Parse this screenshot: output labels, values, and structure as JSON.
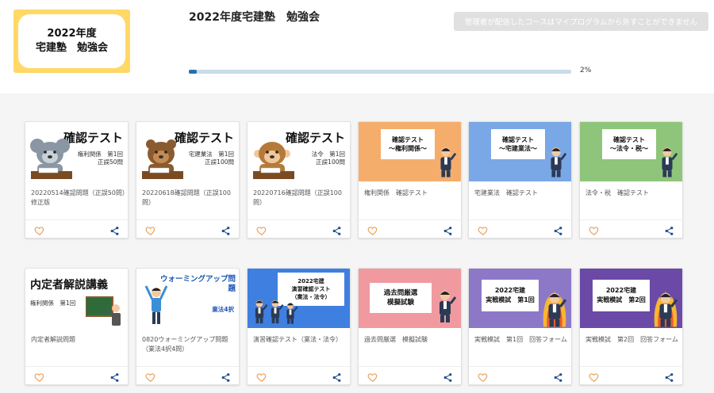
{
  "logo": {
    "line1": "2022年度",
    "line2": "宅建塾　勉強会"
  },
  "course": {
    "title": "2022年度宅建塾　勉強会"
  },
  "notice": {
    "label": "管理者が配信したコースはマイプログラムから外すことができません"
  },
  "progress": {
    "percent": 2,
    "label": "2%"
  },
  "colors": {
    "accent": "#2a6fb0",
    "logo_bg": "#ffd866",
    "heart": "#e9a15a",
    "share": "#1d4f8c"
  },
  "cards": [
    {
      "type": "quiz",
      "thumb_title": "確認テスト",
      "thumb_sub1": "権利関係　第1回",
      "thumb_sub2": "正誤50問",
      "animal": "koala",
      "text": "20220514確認問題（正誤50問）修正版"
    },
    {
      "type": "quiz",
      "thumb_title": "確認テスト",
      "thumb_sub1": "宅建業法　第1回",
      "thumb_sub2": "正誤100問",
      "animal": "bear",
      "text": "20220618確認問題（正誤100問）"
    },
    {
      "type": "quiz",
      "thumb_title": "確認テスト",
      "thumb_sub1": "法令　第1回",
      "thumb_sub2": "正誤100問",
      "animal": "monkey",
      "text": "20220716確認問題（正誤100問）"
    },
    {
      "type": "banner",
      "bg": "#f5ad6c",
      "thumb_line1": "確認テスト",
      "thumb_line2": "～権利関係～",
      "text": "権利関係　確認テスト"
    },
    {
      "type": "banner",
      "bg": "#7aa7e6",
      "thumb_line1": "確認テスト",
      "thumb_line2": "～宅建業法～",
      "text": "宅建業法　確認テスト"
    },
    {
      "type": "banner",
      "bg": "#8fc57a",
      "thumb_line1": "確認テスト",
      "thumb_line2": "～法令・税～",
      "text": "法令・税　確認テスト"
    },
    {
      "type": "lecture",
      "thumb_title": "内定者解説講義",
      "thumb_sub1": "権利関係　第1回",
      "text": "内定者解説問題"
    },
    {
      "type": "warmup",
      "thumb_title": "ウォーミングアップ問題",
      "thumb_sub1": "業法4択",
      "text": "0820ウォーミングアップ問題（業法4択4問）"
    },
    {
      "type": "banner3",
      "bg": "#3f7fe0",
      "thumb_line1": "2022宅建",
      "thumb_line2": "演習確認テスト",
      "thumb_line3": "（業法・法令）",
      "text": "演習確認テスト（業法・法令）"
    },
    {
      "type": "banner2",
      "bg": "#f09aa0",
      "thumb_line1": "過去問厳選",
      "thumb_line2": "模擬試験",
      "text": "過去問厳選　模擬試験"
    },
    {
      "type": "exam",
      "bg": "#8d78c8",
      "thumb_line1": "2022宅建",
      "thumb_line2": "実戦模試　第1回",
      "text": "実戦模試　第1回　回答フォーム"
    },
    {
      "type": "exam",
      "bg": "#6a4aa6",
      "thumb_line1": "2022宅建",
      "thumb_line2": "実戦模試　第2回",
      "text": "実戦模試　第2回　回答フォーム"
    }
  ]
}
